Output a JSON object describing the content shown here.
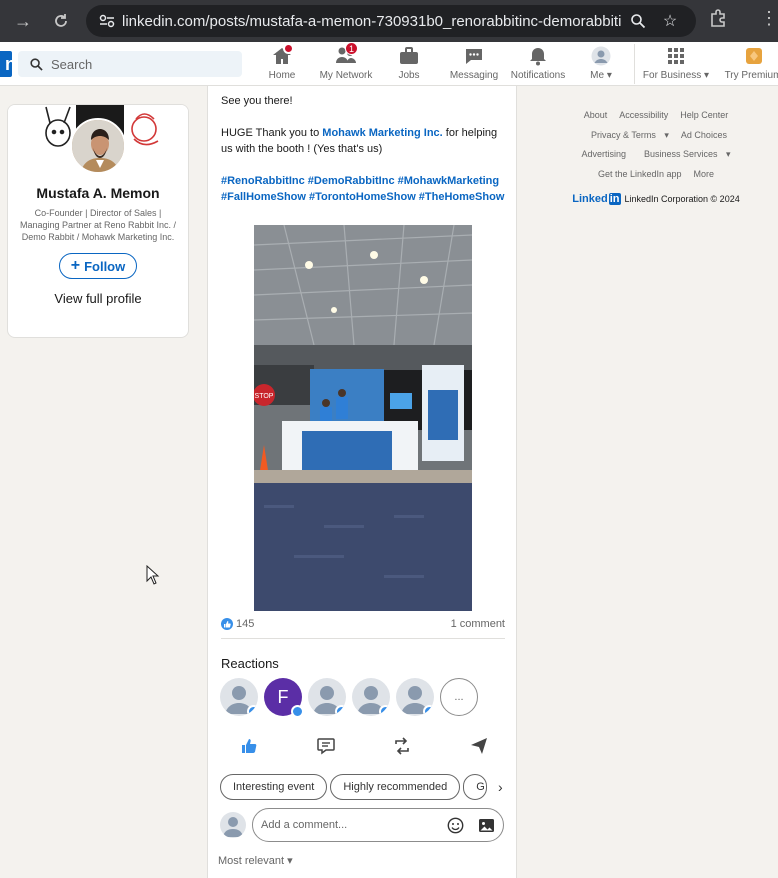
{
  "browser": {
    "url": "linkedin.com/posts/mustafa-a-memon-730931b0_renorabbitinc-demorabbitin..."
  },
  "header": {
    "search_placeholder": "Search",
    "nav": [
      {
        "label": "Home",
        "badge": ""
      },
      {
        "label": "My Network",
        "badge": "1"
      },
      {
        "label": "Jobs",
        "badge": ""
      },
      {
        "label": "Messaging",
        "badge": ""
      },
      {
        "label": "Notifications",
        "badge": ""
      },
      {
        "label": "Me",
        "badge": ""
      },
      {
        "label": "For Business",
        "badge": ""
      },
      {
        "label": "Try Premium",
        "badge": ""
      }
    ]
  },
  "profile": {
    "name": "Mustafa A. Memon",
    "headline": "Co-Founder | Director of Sales | Managing Partner at Reno Rabbit Inc. / Demo Rabbit / Mohawk Marketing Inc.",
    "follow_label": "Follow",
    "view_label": "View full profile"
  },
  "post": {
    "line1": "See you there!",
    "thanks_prefix": "HUGE Thank you to ",
    "thanks_link": "Mohawk Marketing Inc.",
    "thanks_suffix": " for helping us with the booth ! (Yes that's us)",
    "hashtags": "#RenoRabbitInc #DemoRabbitInc #MohawkMarketing #FallHomeShow #TorontoHomeShow #TheHomeShow",
    "like_count": "145",
    "comment_count": "1 comment",
    "reactions_title": "Reactions",
    "reactor_initial": "F",
    "more_reactors": "...",
    "chips": [
      "Interesting event",
      "Highly recommended",
      "G"
    ],
    "comment_placeholder": "Add a comment...",
    "sort_label": "Most relevant"
  },
  "footer": {
    "row1": [
      "About",
      "Accessibility",
      "Help Center"
    ],
    "row2": [
      "Privacy & Terms",
      "Ad Choices"
    ],
    "row3": [
      "Advertising",
      "Business Services"
    ],
    "row4": [
      "Get the LinkedIn app",
      "More"
    ],
    "logo_text": "Linked",
    "logo_in": "in",
    "corp": "LinkedIn Corporation © 2024"
  }
}
